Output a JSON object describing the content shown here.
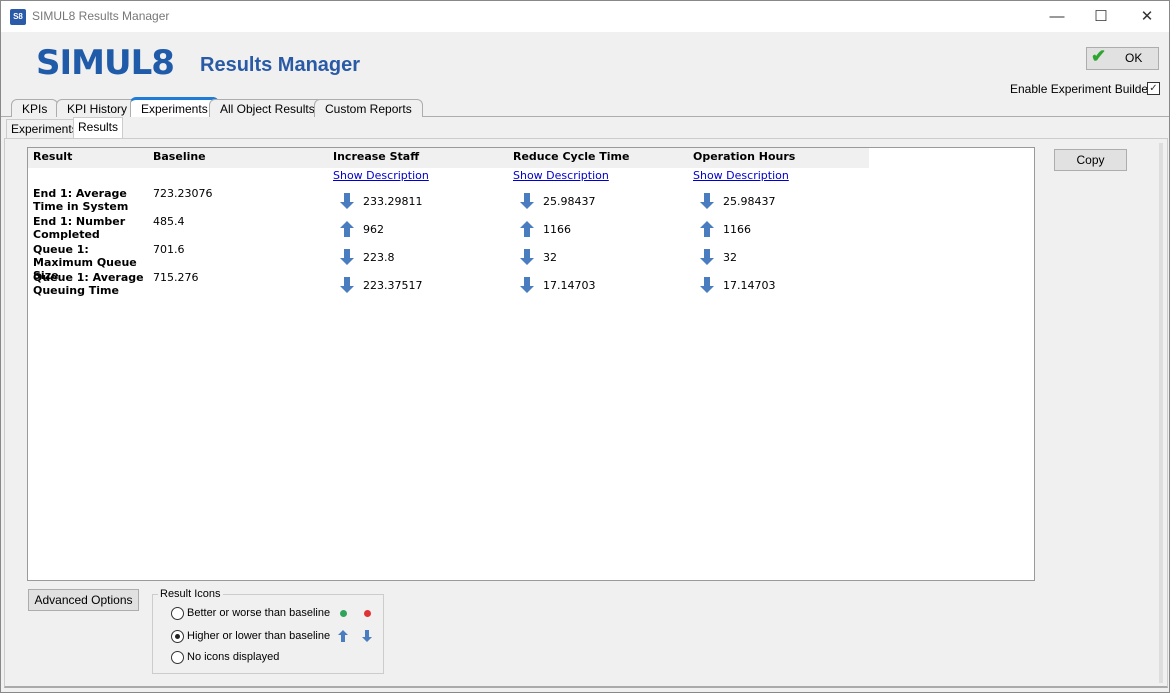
{
  "window": {
    "app_icon": "S8",
    "title": "SIMUL8 Results Manager",
    "minimize": "—",
    "maximize": "☐",
    "close": "✕"
  },
  "header": {
    "logo": "SIMUL8",
    "title": "Results Manager",
    "ok_label": "OK",
    "enable_builder_label": "Enable Experiment Builder",
    "enable_builder_checked": true
  },
  "tabs": [
    {
      "label": "KPIs"
    },
    {
      "label": "KPI History"
    },
    {
      "label": "Experiments",
      "active": true
    },
    {
      "label": "All Object Results"
    },
    {
      "label": "Custom Reports"
    }
  ],
  "subtabs": [
    {
      "label": "Experiments"
    },
    {
      "label": "Results",
      "active": true
    }
  ],
  "table": {
    "headers": [
      "Result",
      "Baseline",
      "Increase Staff",
      "Reduce Cycle Time",
      "Operation Hours"
    ],
    "show_description": "Show Description",
    "rows": [
      {
        "label": "End 1: Average Time in System",
        "baseline": "723.23076",
        "values": [
          {
            "v": "233.29811",
            "dir": "down"
          },
          {
            "v": "25.98437",
            "dir": "down"
          },
          {
            "v": "25.98437",
            "dir": "down"
          }
        ]
      },
      {
        "label": "End 1: Number Completed",
        "baseline": "485.4",
        "values": [
          {
            "v": "962",
            "dir": "up"
          },
          {
            "v": "1166",
            "dir": "up"
          },
          {
            "v": "1166",
            "dir": "up"
          }
        ]
      },
      {
        "label": "Queue 1: Maximum Queue Size",
        "baseline": "701.6",
        "values": [
          {
            "v": "223.8",
            "dir": "down"
          },
          {
            "v": "32",
            "dir": "down"
          },
          {
            "v": "32",
            "dir": "down"
          }
        ]
      },
      {
        "label": "Queue 1: Average Queuing Time",
        "baseline": "715.276",
        "values": [
          {
            "v": "223.37517",
            "dir": "down"
          },
          {
            "v": "17.14703",
            "dir": "down"
          },
          {
            "v": "17.14703",
            "dir": "down"
          }
        ]
      }
    ]
  },
  "copy_label": "Copy",
  "advanced_label": "Advanced Options",
  "result_icons": {
    "title": "Result Icons",
    "options": [
      {
        "label": "Better or worse than baseline",
        "selected": false
      },
      {
        "label": "Higher or lower than baseline",
        "selected": true
      },
      {
        "label": "No icons displayed",
        "selected": false
      }
    ]
  },
  "colors": {
    "arrow": "#4a7cc0",
    "better": "#2ea55a",
    "worse": "#e03333",
    "brand": "#1f5ba8"
  }
}
